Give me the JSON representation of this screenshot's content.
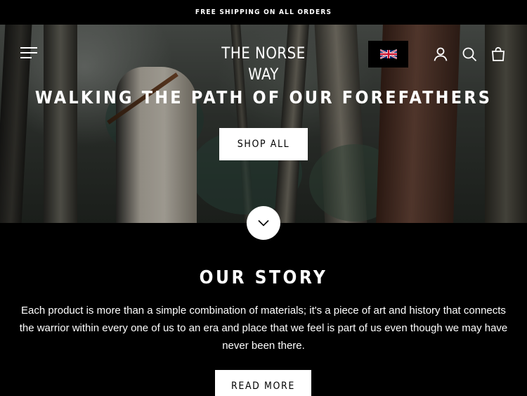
{
  "announcement": {
    "text": "FREE SHIPPING ON ALL ORDERS"
  },
  "header": {
    "logo_text": "THE NORSE WAY",
    "language_flag": "united-kingdom-flag",
    "icons": [
      "menu-icon",
      "account-icon",
      "search-icon",
      "cart-icon"
    ]
  },
  "hero": {
    "title": "WALKING THE PATH OF OUR FOREFATHERS",
    "cta_label": "SHOP ALL",
    "scroll_icon": "chevron-down-icon"
  },
  "story": {
    "title": "OUR STORY",
    "text": "Each product is more than a simple combination of materials; it's a piece of art and history that connects the warrior within every one of us to an era and place that we feel is part of us even though we may have never been there.",
    "cta_label": "READ MORE"
  },
  "colors": {
    "background": "#000000",
    "text": "#ffffff",
    "button_bg": "#ffffff",
    "button_text": "#000000"
  }
}
